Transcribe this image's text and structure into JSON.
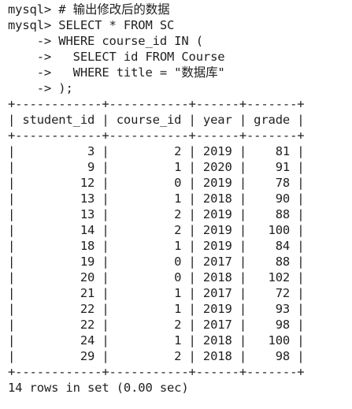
{
  "terminal": {
    "comment_line": "mysql> # 输出修改后的数据",
    "query_lines": [
      "mysql> SELECT * FROM SC",
      "    -> WHERE course_id IN (",
      "    ->   SELECT id FROM Course",
      "    ->   WHERE title = \"数据库\"",
      "    -> );"
    ],
    "table": {
      "border": "+------------+-----------+------+-------+",
      "header": "| student_id | course_id | year | grade |",
      "rows": [
        "|          3 |         2 | 2019 |    81 |",
        "|          9 |         1 | 2020 |    91 |",
        "|         12 |         0 | 2019 |    78 |",
        "|         13 |         1 | 2018 |    90 |",
        "|         13 |         2 | 2019 |    88 |",
        "|         14 |         2 | 2019 |   100 |",
        "|         18 |         1 | 2019 |    84 |",
        "|         19 |         0 | 2017 |    88 |",
        "|         20 |         0 | 2018 |   102 |",
        "|         21 |         1 | 2017 |    72 |",
        "|         22 |         1 | 2019 |    93 |",
        "|         22 |         2 | 2017 |    98 |",
        "|         24 |         1 | 2018 |   100 |",
        "|         29 |         2 | 2018 |    98 |"
      ]
    },
    "summary": "14 rows in set (0.00 sec)"
  }
}
